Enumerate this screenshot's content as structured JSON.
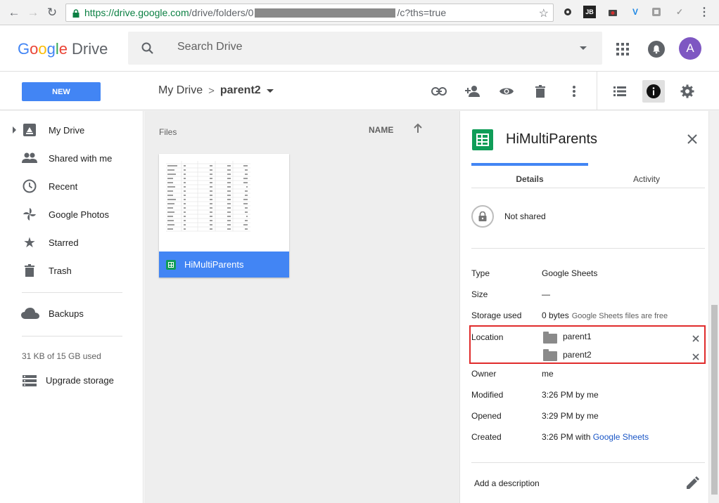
{
  "browser": {
    "url_secure": "https://drive.google.com",
    "url_path_start": "/drive/folders/0",
    "url_path_end": "/c?ths=true",
    "extensions": [
      "gear",
      "JB",
      "camera",
      "V",
      "square",
      "pen"
    ]
  },
  "header": {
    "logo_google": "Google",
    "logo_drive": "Drive",
    "search_placeholder": "Search Drive",
    "avatar_letter": "A"
  },
  "toolbar": {
    "new_label": "NEW",
    "breadcrumb_root": "My Drive",
    "breadcrumb_separator": ">",
    "breadcrumb_current": "parent2"
  },
  "sidebar": {
    "items": [
      {
        "label": "My Drive",
        "icon": "my-drive-icon"
      },
      {
        "label": "Shared with me",
        "icon": "people-icon"
      },
      {
        "label": "Recent",
        "icon": "clock-icon"
      },
      {
        "label": "Google Photos",
        "icon": "pinwheel-icon"
      },
      {
        "label": "Starred",
        "icon": "star-icon"
      },
      {
        "label": "Trash",
        "icon": "trash-icon"
      },
      {
        "label": "Backups",
        "icon": "cloud-icon"
      }
    ],
    "storage_used": "31 KB of 15 GB used",
    "upgrade_label": "Upgrade storage"
  },
  "main": {
    "files_label": "Files",
    "sort_label": "NAME",
    "file": {
      "name": "HiMultiParents"
    }
  },
  "details": {
    "title": "HiMultiParents",
    "tabs": [
      "Details",
      "Activity"
    ],
    "sharing": "Not shared",
    "properties": {
      "type_label": "Type",
      "type_value": "Google Sheets",
      "size_label": "Size",
      "size_value": "—",
      "storage_label": "Storage used",
      "storage_value": "0 bytes",
      "storage_note": "Google Sheets files are free",
      "location_label": "Location",
      "owner_label": "Owner",
      "owner_value": "me",
      "modified_label": "Modified",
      "modified_value": "3:26 PM by me",
      "opened_label": "Opened",
      "opened_value": "3:29 PM by me",
      "created_label": "Created",
      "created_value": "3:26 PM with",
      "created_app": "Google Sheets"
    },
    "locations": [
      "parent1",
      "parent2"
    ],
    "add_description": "Add a description"
  },
  "colors": {
    "accent_blue": "#4285f4",
    "sheets_green": "#0f9d58",
    "highlight_red": "#e02b2b",
    "avatar_purple": "#7e57c2"
  }
}
